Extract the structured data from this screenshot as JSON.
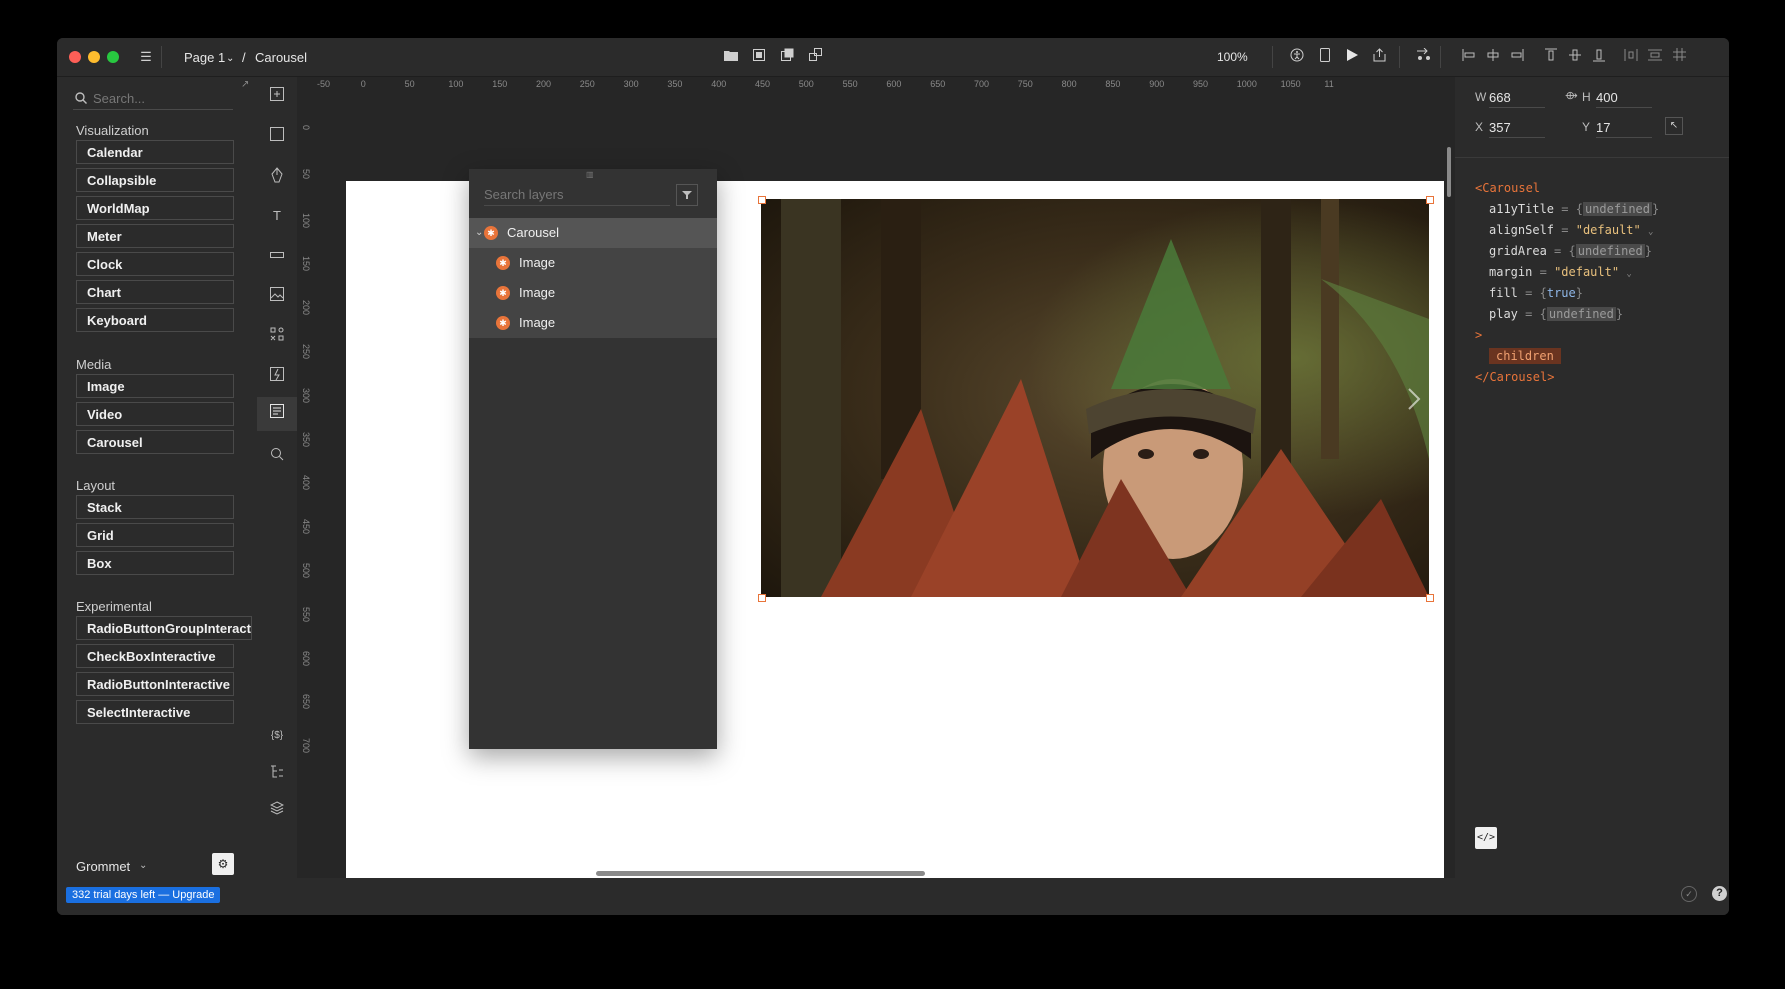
{
  "titlebar": {
    "page": "Page 1",
    "separator": "/",
    "breadcrumb": "Carousel",
    "zoom": "100%"
  },
  "left": {
    "search_placeholder": "Search...",
    "sections": [
      {
        "title": "Visualization",
        "items": [
          "Calendar",
          "Collapsible",
          "WorldMap",
          "Meter",
          "Clock",
          "Chart",
          "Keyboard"
        ]
      },
      {
        "title": "Media",
        "items": [
          "Image",
          "Video",
          "Carousel"
        ]
      },
      {
        "title": "Layout",
        "items": [
          "Stack",
          "Grid",
          "Box"
        ]
      },
      {
        "title": "Experimental",
        "items": [
          "RadioButtonGroupInteractive",
          "CheckBoxInteractive",
          "RadioButtonInteractive",
          "SelectInteractive"
        ]
      }
    ],
    "library": "Grommet"
  },
  "ruler": {
    "top": [
      "-50",
      "0",
      "50",
      "100",
      "150",
      "200",
      "250",
      "300",
      "350",
      "400",
      "450",
      "500",
      "550",
      "600",
      "650",
      "700",
      "750",
      "800",
      "850",
      "900",
      "950",
      "1000",
      "1050",
      "11"
    ],
    "left": [
      "0",
      "50",
      "100",
      "150",
      "200",
      "250",
      "300",
      "350",
      "400",
      "450",
      "500",
      "550",
      "600",
      "650",
      "700"
    ]
  },
  "layers": {
    "search_placeholder": "Search layers",
    "items": [
      {
        "label": "Carousel",
        "level": 0
      },
      {
        "label": "Image",
        "level": 1
      },
      {
        "label": "Image",
        "level": 1
      },
      {
        "label": "Image",
        "level": 1
      }
    ]
  },
  "props": {
    "w_label": "W",
    "w": "668",
    "h_label": "H",
    "h": "400",
    "x_label": "X",
    "x": "357",
    "y_label": "Y",
    "y": "17"
  },
  "code": {
    "open": "<Carousel",
    "a11y_name": "a11yTitle",
    "a11y_val": "undefined",
    "alignself_name": "alignSelf",
    "alignself_val": "\"default\"",
    "gridarea_name": "gridArea",
    "gridarea_val": "undefined",
    "margin_name": "margin",
    "margin_val": "\"default\"",
    "fill_name": "fill",
    "fill_val": "true",
    "play_name": "play",
    "play_val": "undefined",
    "close_bracket": ">",
    "children": "children",
    "close": "</Carousel>"
  },
  "status": {
    "trial": "332 trial days left — Upgrade"
  },
  "colors": {
    "accent": "#e8743a",
    "trial_bg": "#1a6fe0"
  }
}
